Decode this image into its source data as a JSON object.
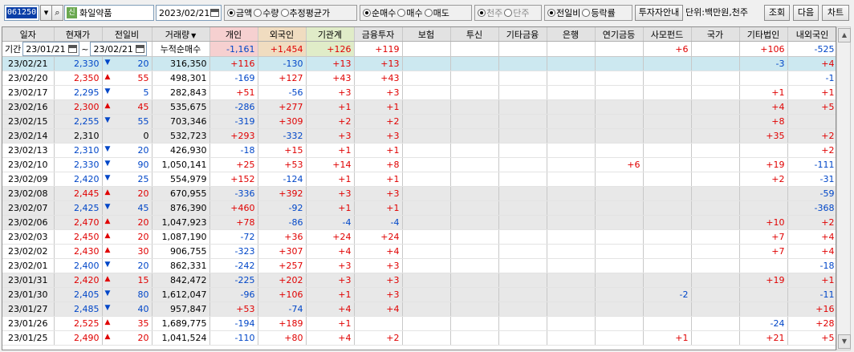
{
  "toolbar": {
    "code": "061250",
    "name": "화일약품",
    "name_badge": "신",
    "date": "2023/02/21",
    "group1": [
      "금액",
      "수량",
      "추정평균가"
    ],
    "group1_selected": 0,
    "group2": [
      "순매수",
      "매수",
      "매도"
    ],
    "group2_selected": 0,
    "group3": [
      "천주",
      "단주"
    ],
    "group3_selected": 0,
    "group4": [
      "전일비",
      "등락률"
    ],
    "group4_selected": 0,
    "investor_info": "투자자안내",
    "unit": "단위:백만원,천주",
    "query": "조회",
    "next": "다음",
    "chart": "차트"
  },
  "summary": {
    "period_label": "기간",
    "from": "23/01/21",
    "to": "23/02/21",
    "cumulative_label": "누적순매수",
    "values": [
      "-1,161",
      "+1,454",
      "+126",
      "+119",
      "",
      "",
      "",
      "",
      "",
      "+6",
      "",
      "+106",
      "-525"
    ]
  },
  "colors": {
    "up": "#e00000",
    "down": "#0046c8",
    "selected_row": "#cce8f0",
    "individual_header": "#f6d0d0",
    "foreign_header": "#f0dcc0",
    "institution_header": "#e0ecc8"
  },
  "headers": [
    "일자",
    "현재가",
    "전일비",
    "거래량",
    "개인",
    "외국인",
    "기관계",
    "금융투자",
    "보험",
    "투신",
    "기타금융",
    "은행",
    "연기금등",
    "사모펀드",
    "국가",
    "기타법인",
    "내외국인"
  ],
  "rows": [
    {
      "date": "23/02/21",
      "price": "2,330",
      "dir": "down",
      "chg": "20",
      "vol": "316,350",
      "v": [
        "+116",
        "-130",
        "+13",
        "+13",
        "",
        "",
        "",
        "",
        "",
        "",
        "",
        "-3",
        "+4"
      ]
    },
    {
      "date": "23/02/20",
      "price": "2,350",
      "dir": "up",
      "chg": "55",
      "vol": "498,301",
      "v": [
        "-169",
        "+127",
        "+43",
        "+43",
        "",
        "",
        "",
        "",
        "",
        "",
        "",
        "",
        "-1"
      ]
    },
    {
      "date": "23/02/17",
      "price": "2,295",
      "dir": "down",
      "chg": "5",
      "vol": "282,843",
      "v": [
        "+51",
        "-56",
        "+3",
        "+3",
        "",
        "",
        "",
        "",
        "",
        "",
        "",
        "+1",
        "+1"
      ]
    },
    {
      "date": "23/02/16",
      "price": "2,300",
      "dir": "up",
      "chg": "45",
      "vol": "535,675",
      "v": [
        "-286",
        "+277",
        "+1",
        "+1",
        "",
        "",
        "",
        "",
        "",
        "",
        "",
        "+4",
        "+5"
      ]
    },
    {
      "date": "23/02/15",
      "price": "2,255",
      "dir": "down",
      "chg": "55",
      "vol": "703,346",
      "v": [
        "-319",
        "+309",
        "+2",
        "+2",
        "",
        "",
        "",
        "",
        "",
        "",
        "",
        "+8",
        ""
      ]
    },
    {
      "date": "23/02/14",
      "price": "2,310",
      "dir": "flat",
      "chg": "0",
      "vol": "532,723",
      "v": [
        "+293",
        "-332",
        "+3",
        "+3",
        "",
        "",
        "",
        "",
        "",
        "",
        "",
        "+35",
        "+2"
      ]
    },
    {
      "date": "23/02/13",
      "price": "2,310",
      "dir": "down",
      "chg": "20",
      "vol": "426,930",
      "v": [
        "-18",
        "+15",
        "+1",
        "+1",
        "",
        "",
        "",
        "",
        "",
        "",
        "",
        "",
        "+2"
      ]
    },
    {
      "date": "23/02/10",
      "price": "2,330",
      "dir": "down",
      "chg": "90",
      "vol": "1,050,141",
      "v": [
        "+25",
        "+53",
        "+14",
        "+8",
        "",
        "",
        "",
        "",
        "+6",
        "",
        "",
        "+19",
        "-111"
      ]
    },
    {
      "date": "23/02/09",
      "price": "2,420",
      "dir": "down",
      "chg": "25",
      "vol": "554,979",
      "v": [
        "+152",
        "-124",
        "+1",
        "+1",
        "",
        "",
        "",
        "",
        "",
        "",
        "",
        "+2",
        "-31"
      ]
    },
    {
      "date": "23/02/08",
      "price": "2,445",
      "dir": "up",
      "chg": "20",
      "vol": "670,955",
      "v": [
        "-336",
        "+392",
        "+3",
        "+3",
        "",
        "",
        "",
        "",
        "",
        "",
        "",
        "",
        "-59"
      ]
    },
    {
      "date": "23/02/07",
      "price": "2,425",
      "dir": "down",
      "chg": "45",
      "vol": "876,390",
      "v": [
        "+460",
        "-92",
        "+1",
        "+1",
        "",
        "",
        "",
        "",
        "",
        "",
        "",
        "",
        "-368"
      ]
    },
    {
      "date": "23/02/06",
      "price": "2,470",
      "dir": "up",
      "chg": "20",
      "vol": "1,047,923",
      "v": [
        "+78",
        "-86",
        "-4",
        "-4",
        "",
        "",
        "",
        "",
        "",
        "",
        "",
        "+10",
        "+2"
      ]
    },
    {
      "date": "23/02/03",
      "price": "2,450",
      "dir": "up",
      "chg": "20",
      "vol": "1,087,190",
      "v": [
        "-72",
        "+36",
        "+24",
        "+24",
        "",
        "",
        "",
        "",
        "",
        "",
        "",
        "+7",
        "+4"
      ]
    },
    {
      "date": "23/02/02",
      "price": "2,430",
      "dir": "up",
      "chg": "30",
      "vol": "906,755",
      "v": [
        "-323",
        "+307",
        "+4",
        "+4",
        "",
        "",
        "",
        "",
        "",
        "",
        "",
        "+7",
        "+4"
      ]
    },
    {
      "date": "23/02/01",
      "price": "2,400",
      "dir": "down",
      "chg": "20",
      "vol": "862,331",
      "v": [
        "-242",
        "+257",
        "+3",
        "+3",
        "",
        "",
        "",
        "",
        "",
        "",
        "",
        "",
        "-18"
      ]
    },
    {
      "date": "23/01/31",
      "price": "2,420",
      "dir": "up",
      "chg": "15",
      "vol": "842,472",
      "v": [
        "-225",
        "+202",
        "+3",
        "+3",
        "",
        "",
        "",
        "",
        "",
        "",
        "",
        "+19",
        "+1"
      ]
    },
    {
      "date": "23/01/30",
      "price": "2,405",
      "dir": "down",
      "chg": "80",
      "vol": "1,612,047",
      "v": [
        "-96",
        "+106",
        "+1",
        "+3",
        "",
        "",
        "",
        "",
        "",
        "-2",
        "",
        "",
        "-11"
      ]
    },
    {
      "date": "23/01/27",
      "price": "2,485",
      "dir": "down",
      "chg": "40",
      "vol": "957,847",
      "v": [
        "+53",
        "-74",
        "+4",
        "+4",
        "",
        "",
        "",
        "",
        "",
        "",
        "",
        "",
        "+16"
      ]
    },
    {
      "date": "23/01/26",
      "price": "2,525",
      "dir": "up",
      "chg": "35",
      "vol": "1,689,775",
      "v": [
        "-194",
        "+189",
        "+1",
        "",
        "",
        "",
        "",
        "",
        "",
        "",
        "",
        "-24",
        "+28"
      ]
    },
    {
      "date": "23/01/25",
      "price": "2,490",
      "dir": "up",
      "chg": "20",
      "vol": "1,041,524",
      "v": [
        "-110",
        "+80",
        "+4",
        "+2",
        "",
        "",
        "",
        "",
        "",
        "+1",
        "",
        "+21",
        "+5"
      ]
    }
  ]
}
